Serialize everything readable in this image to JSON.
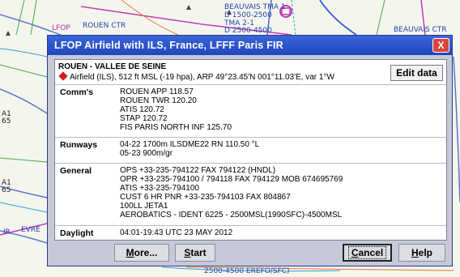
{
  "map": {
    "labels": [
      {
        "name": "map-label-lfop",
        "text": "LFOP"
      },
      {
        "name": "map-label-rouen-ctr",
        "text": "ROUEN CTR"
      },
      {
        "name": "map-label-beauvais-tma1",
        "text": "BEAUVAIS TMA 1"
      },
      {
        "name": "map-label-d1500",
        "text": "D 1500-2500"
      },
      {
        "name": "map-label-tma2",
        "text": "TMA 2-1"
      },
      {
        "name": "map-label-d2500",
        "text": "D 2500-4500"
      },
      {
        "name": "map-label-beauvais-ctr",
        "text": "BEAUVAIS CTR"
      },
      {
        "name": "map-label-a1-upper",
        "text": "A1"
      },
      {
        "name": "map-label-65-upper",
        "text": "65"
      },
      {
        "name": "map-label-a1-lower",
        "text": "A1"
      },
      {
        "name": "map-label-65-lower",
        "text": "65"
      },
      {
        "name": "map-label-ir",
        "text": "IR"
      },
      {
        "name": "map-label-evre",
        "text": "EVRE"
      },
      {
        "name": "map-label-bottom",
        "text": "2500-4500 EREFO/SFC)"
      }
    ]
  },
  "dialog": {
    "title": "LFOP  Airfield with ILS, France, LFFF Paris FIR",
    "close_glyph": "X",
    "airfield_name": "ROUEN - VALLEE DE SEINE",
    "airfield_details": "Airfield (ILS), 512 ft MSL (-19 hpa),  ARP 49°23.45'N 001°11.03'E, var 1°W",
    "edit_data_label": "Edit data",
    "sections": [
      {
        "label": "Comm's",
        "lines": [
          "ROUEN APP 118.57",
          "ROUEN TWR 120.20",
          "ATIS 120.72",
          "STAP 120.72",
          "FIS PARIS NORTH INF 125.70"
        ]
      },
      {
        "label": "Runways",
        "lines": [
          "04-22 1700m  ILSDME22 RN 110.50 °L",
          "05-23 900m/gr"
        ]
      },
      {
        "label": "General",
        "lines": [
          "OPS +33-235-794122  FAX 794122 (HNDL)",
          "OPR +33-235-794100 / 794118  FAX 794129  MOB 674695769",
          "ATIS +33-235-794100",
          "CUST 6 HR PNR +33-235-794103  FAX 804867",
          "100LL JETA1",
          "AEROBATICS - IDENT 6225 - 2500MSL(1990SFC)-4500MSL"
        ]
      },
      {
        "label": "Daylight",
        "lines": [
          "04:01-19:43 UTC 23 MAY 2012"
        ]
      }
    ],
    "buttons": {
      "more": {
        "u": "M",
        "rest": "ore..."
      },
      "start": {
        "u": "S",
        "rest": "tart"
      },
      "cancel": {
        "u": "C",
        "rest": "ancel"
      },
      "help": {
        "u": "H",
        "rest": "elp"
      }
    }
  }
}
